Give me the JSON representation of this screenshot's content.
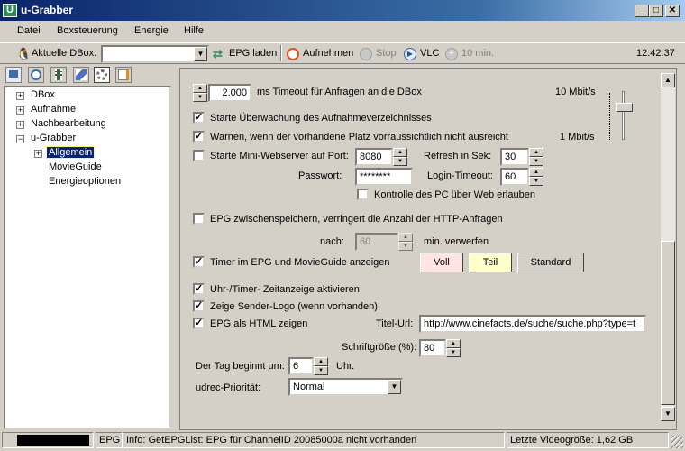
{
  "window": {
    "title": "u-Grabber",
    "icon_letter": "U"
  },
  "menu": [
    "Datei",
    "Boxsteuerung",
    "Energie",
    "Hilfe"
  ],
  "toolbar": {
    "dbox_label": "Aktuelle DBox:",
    "dbox_value": "",
    "epg_label": "EPG laden",
    "record_label": "Aufnehmen",
    "stop_label": "Stop",
    "vlc_label": "VLC",
    "timer_label": "10 min.",
    "clock": "12:42:37"
  },
  "tree": {
    "items": [
      "DBox",
      "Aufnahme",
      "Nachbearbeitung",
      "u-Grabber",
      "Allgemein",
      "MovieGuide",
      "Energieoptionen"
    ]
  },
  "settings": {
    "timeout_value": "2.000",
    "timeout_label": "ms Timeout für Anfragen an die DBox",
    "rate_top": "10 Mbit/s",
    "rate_bottom": "1 Mbit/s",
    "monitor_label": "Starte Überwachung des Aufnahmeverzeichnisses",
    "warn_label": "Warnen, wenn der vorhandene Platz vorraussichtlich nicht ausreicht",
    "webserver_label": "Starte Mini-Webserver auf Port:",
    "port_value": "8080",
    "refresh_label": "Refresh in Sek:",
    "refresh_value": "30",
    "password_label": "Passwort:",
    "password_value": "********",
    "login_label": "Login-Timeout:",
    "login_value": "60",
    "webcontrol_label": "Kontrolle des PC über Web erlauben",
    "epgcache_label": "EPG zwischenspeichern, verringert die Anzahl der HTTP-Anfragen",
    "after_label": "nach:",
    "after_value": "60",
    "discard_label": "min. verwerfen",
    "timer_epg_label": "Timer im EPG und MovieGuide anzeigen",
    "btn_full": "Voll",
    "btn_part": "Teil",
    "btn_standard": "Standard",
    "clock_label": "Uhr-/Timer- Zeitanzeige aktivieren",
    "logo_label": "Zeige Sender-Logo (wenn vorhanden)",
    "epghtml_label": "EPG als HTML zeigen",
    "title_url_label": "Titel-Url:",
    "title_url_value": "http://www.cinefacts.de/suche/suche.php?type=t",
    "fontsize_label": "Schriftgröße (%):",
    "fontsize_value": "80",
    "daystart_label": "Der Tag beginnt um:",
    "daystart_value": "6",
    "daystart_unit": "Uhr.",
    "priority_label": "udrec-Priorität:",
    "priority_value": "Normal"
  },
  "status": {
    "epg": "EPG",
    "info": "Info: GetEPGList: EPG für ChannelID 20085000a nicht vorhanden",
    "size": "Letzte Videogröße: 1,62 GB"
  },
  "colors": {
    "full": "#ffe4e1",
    "part": "#ffffcc",
    "titlebar": "#0a246a"
  }
}
